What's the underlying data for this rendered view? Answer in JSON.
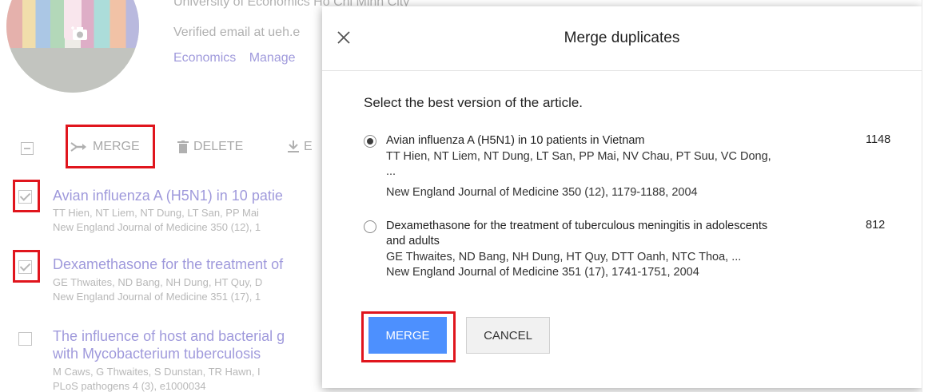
{
  "profile": {
    "affiliation": "University of Economics Ho Chi Minh City",
    "verified_email": "Verified email at ueh.e",
    "interests": [
      "Economics",
      "Manage"
    ]
  },
  "toolbar": {
    "merge_label": "MERGE",
    "delete_label": "DELETE",
    "export_label": "E"
  },
  "articles": [
    {
      "checked": true,
      "title": "Avian influenza A (H5N1) in 10 patie",
      "authors": "TT Hien, NT Liem, NT Dung, LT San, PP Mai",
      "venue": "New England Journal of Medicine 350 (12), 1"
    },
    {
      "checked": true,
      "title": "Dexamethasone for the treatment of",
      "authors": "GE Thwaites, ND Bang, NH Dung, HT Quy, D",
      "venue": "New England Journal of Medicine 351 (17), 1"
    },
    {
      "checked": false,
      "title": "The influence of host and bacterial g",
      "title_line2": "with Mycobacterium tuberculosis",
      "authors": "M Caws, G Thwaites, S Dunstan, TR Hawn, I",
      "venue": "PLoS pathogens 4 (3), e1000034"
    }
  ],
  "dialog": {
    "title": "Merge duplicates",
    "prompt": "Select the best version of the article.",
    "options": [
      {
        "selected": true,
        "title": "Avian influenza A (H5N1) in 10 patients in Vietnam",
        "count": "1148",
        "authors": "TT Hien, NT Liem, NT Dung, LT San, PP Mai, NV Chau, PT Suu, VC Dong,",
        "authors_more": "...",
        "venue": "New England Journal of Medicine 350 (12), 1179-1188, 2004"
      },
      {
        "selected": false,
        "title": "Dexamethasone for the treatment of tuberculous meningitis in adolescents",
        "title_line2": "and adults",
        "count": "812",
        "authors": "GE Thwaites, ND Bang, NH Dung, HT Quy, DTT Oanh, NTC Thoa, ...",
        "venue": "New England Journal of Medicine 351 (17), 1741-1751, 2004"
      }
    ],
    "merge_label": "MERGE",
    "cancel_label": "CANCEL"
  },
  "colors": {
    "link": "#1a0dab",
    "primary_button": "#4d90fe",
    "highlight_box": "#e0151d"
  }
}
